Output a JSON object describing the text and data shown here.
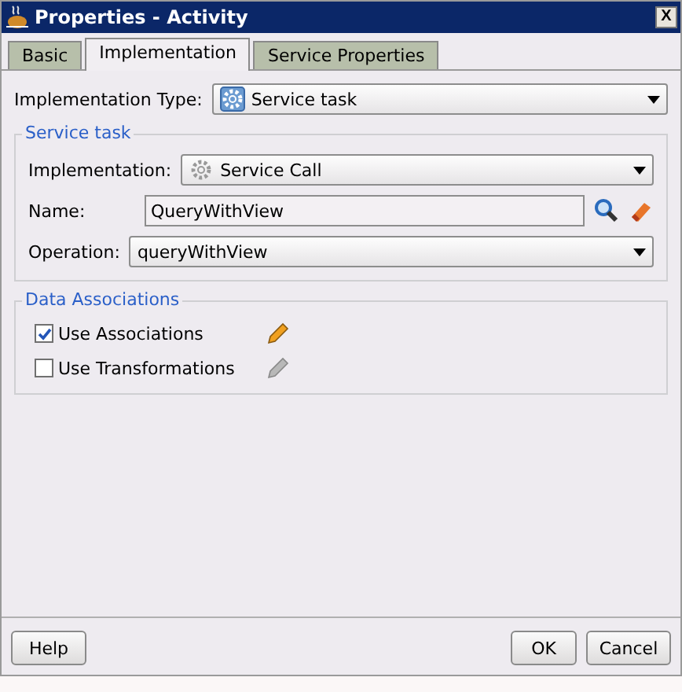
{
  "window": {
    "title": "Properties - Activity",
    "close": "X"
  },
  "tabs": [
    {
      "label": "Basic",
      "selected": false
    },
    {
      "label": "Implementation",
      "selected": true
    },
    {
      "label": "Service Properties",
      "selected": false
    }
  ],
  "implementation_type": {
    "label": "Implementation Type:",
    "value": "Service task"
  },
  "service_task": {
    "title": "Service task",
    "implementation": {
      "label": "Implementation:",
      "value": "Service Call"
    },
    "name": {
      "label": "Name:",
      "value": "QueryWithView"
    },
    "operation": {
      "label": "Operation:",
      "value": "queryWithView"
    }
  },
  "data_associations": {
    "title": "Data Associations",
    "options": [
      {
        "label": "Use Associations",
        "checked": true,
        "edit_disabled": false
      },
      {
        "label": "Use Transformations",
        "checked": false,
        "edit_disabled": true
      }
    ]
  },
  "buttons": {
    "help": "Help",
    "ok": "OK",
    "cancel": "Cancel"
  }
}
